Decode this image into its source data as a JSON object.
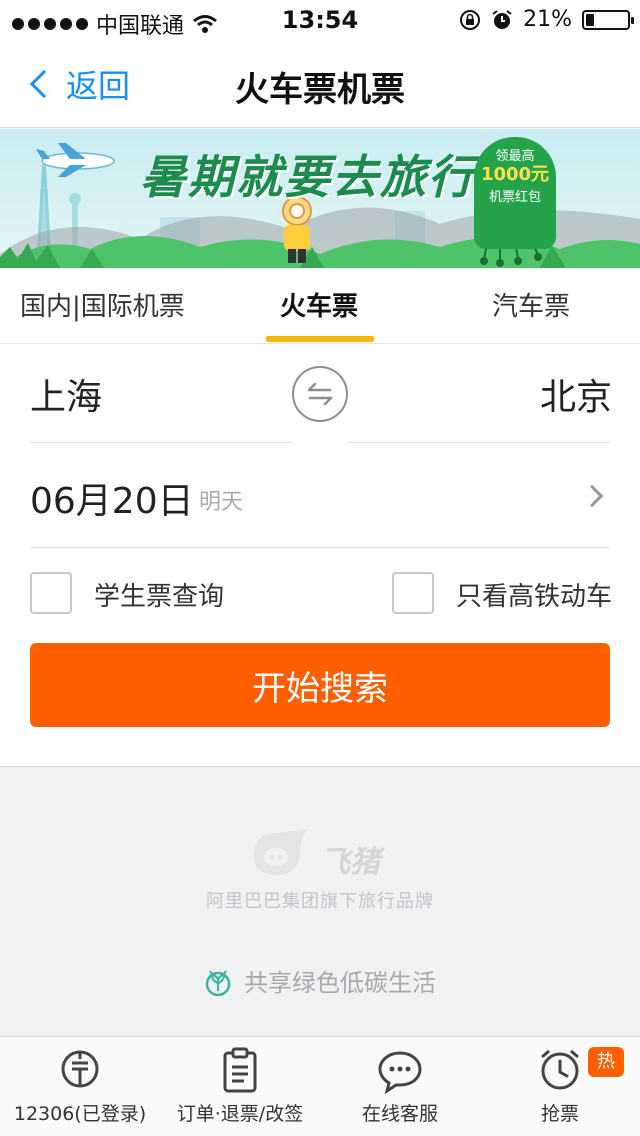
{
  "status_bar": {
    "carrier": "中国联通",
    "time": "13:54",
    "battery": "21%",
    "battery_level": 0.21
  },
  "nav": {
    "back_label": "返回",
    "title": "火车票机票"
  },
  "banner": {
    "headline": "暑期就要去旅行",
    "badge_top": "领最高",
    "badge_amount": "1000元",
    "badge_bottom": "机票红包"
  },
  "tabs": [
    {
      "label": "国内|国际机票",
      "active": false
    },
    {
      "label": "火车票",
      "active": true
    },
    {
      "label": "汽车票",
      "active": false
    }
  ],
  "form": {
    "from_city": "上海",
    "to_city": "北京",
    "date": "06月20日",
    "date_hint": "明天",
    "student_label": "学生票查询",
    "highspeed_label": "只看高铁动车",
    "search_label": "开始搜索"
  },
  "footer": {
    "brand_name": "飞猪",
    "tagline": "阿里巴巴集团旗下旅行品牌",
    "green_slogan": "共享绿色低碳生活"
  },
  "bottom_nav": [
    {
      "label": "12306(已登录)",
      "icon": "train-icon"
    },
    {
      "label": "订单·退票/改签",
      "icon": "clipboard-icon"
    },
    {
      "label": "在线客服",
      "icon": "chat-bubble-icon"
    },
    {
      "label": "抢票",
      "icon": "alarm-clock-icon",
      "badge": "热"
    }
  ],
  "colors": {
    "accent_blue": "#1a8ff1",
    "tab_underline": "#f5b800",
    "search_button": "#ff5f00",
    "hot_badge": "#ff5f00"
  }
}
